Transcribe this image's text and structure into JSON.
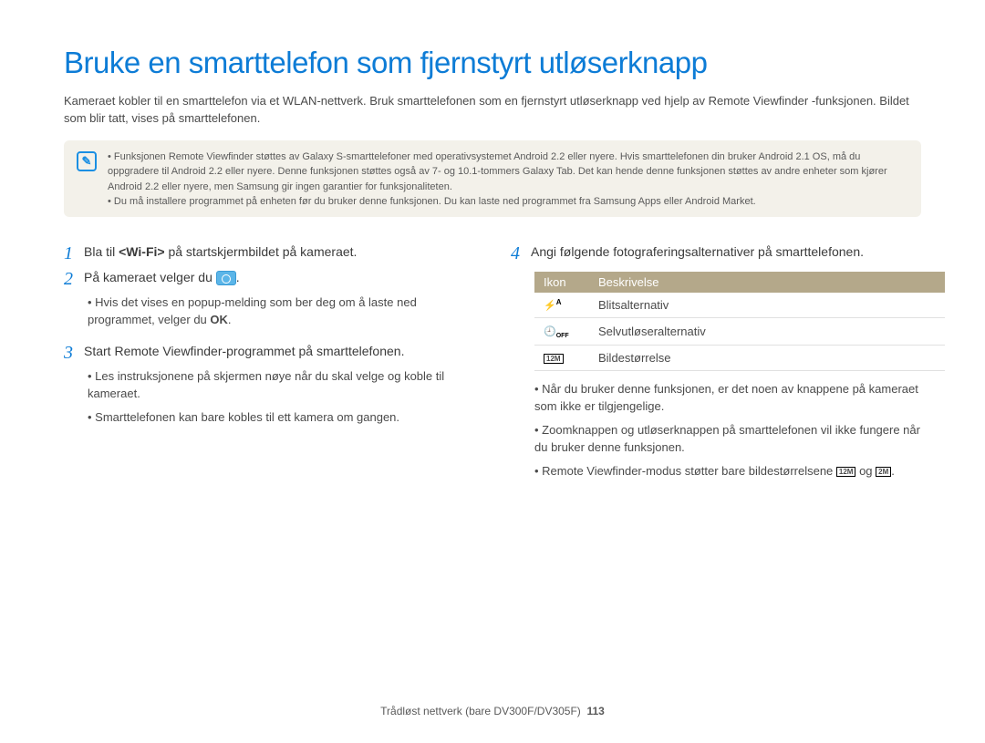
{
  "title": "Bruke en smarttelefon som fjernstyrt utløserknapp",
  "intro": "Kameraet kobler til en smarttelefon via et WLAN-nettverk. Bruk smarttelefonen som en fjernstyrt utløserknapp ved hjelp av Remote Viewfinder -funksjonen. Bildet som blir tatt, vises på smarttelefonen.",
  "note": {
    "bullets": [
      "Funksjonen Remote Viewfinder støttes av Galaxy S-smarttelefoner med operativsystemet Android 2.2 eller nyere. Hvis smarttelefonen din bruker Android 2.1 OS, må du oppgradere til Android 2.2 eller nyere. Denne funksjonen støttes også av 7- og 10.1-tommers Galaxy Tab. Det kan hende denne funksjonen støttes av andre enheter som kjører Android 2.2 eller nyere, men Samsung gir ingen garantier for funksjonaliteten.",
      "Du må installere programmet på enheten før du bruker denne funksjonen. Du kan laste ned programmet fra Samsung Apps eller Android Market."
    ]
  },
  "steps": {
    "s1": {
      "num": "1",
      "text_pre": "Bla til ",
      "bold": "<Wi-Fi>",
      "text_post": " på startskjermbildet på kameraet."
    },
    "s2": {
      "num": "2",
      "text_pre": "På kameraet velger du ",
      "text_post": "."
    },
    "s2_bullets": [
      "Hvis det vises en popup-melding som ber deg om å laste ned programmet, velger du OK."
    ],
    "s3": {
      "num": "3",
      "text": "Start Remote Viewfinder-programmet på smarttelefonen."
    },
    "s3_bullets": [
      "Les instruksjonene på skjermen nøye når du skal velge og koble til kameraet.",
      "Smarttelefonen kan bare kobles til ett kamera om gangen."
    ],
    "s4": {
      "num": "4",
      "text": "Angi følgende fotograferingsalternativer på smarttelefonen."
    },
    "s4_bullets": [
      "Når du bruker denne funksjonen, er det noen av knappene på kameraet som ikke er tilgjengelige.",
      "Zoomknappen og utløserknappen på smarttelefonen vil ikke fungere når du bruker denne funksjonen.",
      "Remote Viewfinder-modus støtter bare bildestørrelsene 12M og 2M."
    ]
  },
  "table": {
    "headers": {
      "icon": "Ikon",
      "desc": "Beskrivelse"
    },
    "rows": [
      {
        "icon_name": "flash-icon",
        "label": "Blitsalternativ"
      },
      {
        "icon_name": "selftimer-icon",
        "label": "Selvutløseralternativ"
      },
      {
        "icon_name": "resolution-icon",
        "label": "Bildestørrelse"
      }
    ]
  },
  "footer": {
    "text": "Trådløst nettverk (bare DV300F/DV305F)",
    "page": "113"
  }
}
